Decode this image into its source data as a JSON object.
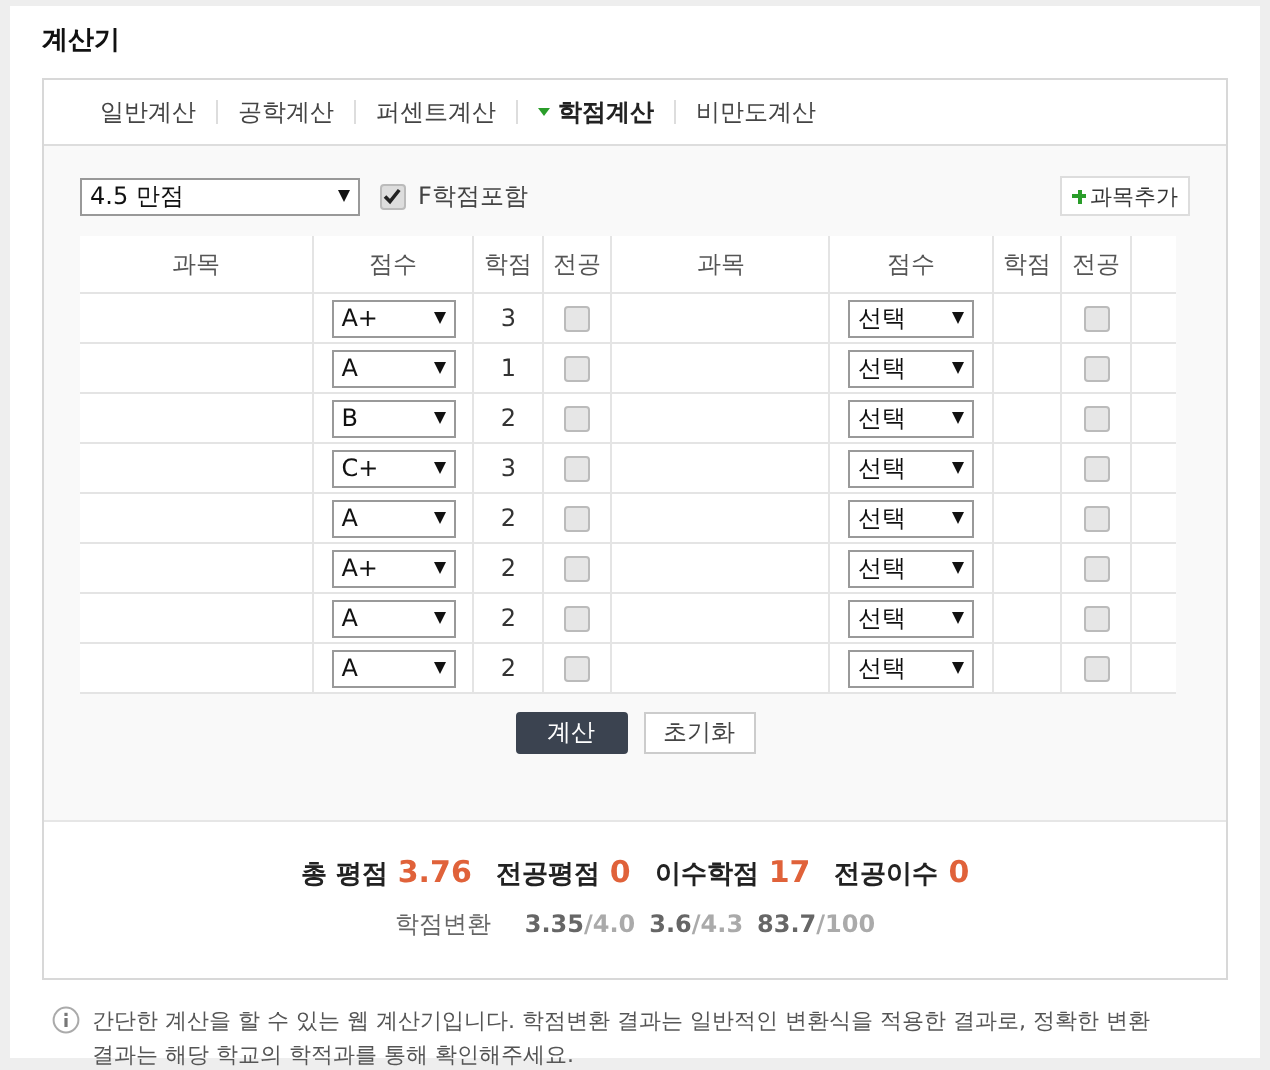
{
  "title": "계산기",
  "tabs": [
    {
      "label": "일반계산",
      "selected": false
    },
    {
      "label": "공학계산",
      "selected": false
    },
    {
      "label": "퍼센트계산",
      "selected": false
    },
    {
      "label": "학점계산",
      "selected": true
    },
    {
      "label": "비만도계산",
      "selected": false
    }
  ],
  "scale_select": {
    "value": "4.5 만점"
  },
  "include_f": {
    "label": "F학점포함",
    "checked": true
  },
  "add_button": {
    "label": "과목추가"
  },
  "table": {
    "columns": [
      "과목",
      "점수",
      "학점",
      "전공",
      "과목",
      "점수",
      "학점",
      "전공"
    ],
    "rows": [
      {
        "left": {
          "grade": "A+",
          "credit": "3",
          "major": false
        },
        "right": {
          "grade": "선택",
          "major": false
        }
      },
      {
        "left": {
          "grade": "A",
          "credit": "1",
          "major": false
        },
        "right": {
          "grade": "선택",
          "major": false
        }
      },
      {
        "left": {
          "grade": "B",
          "credit": "2",
          "major": false
        },
        "right": {
          "grade": "선택",
          "major": false
        }
      },
      {
        "left": {
          "grade": "C+",
          "credit": "3",
          "major": false
        },
        "right": {
          "grade": "선택",
          "major": false
        }
      },
      {
        "left": {
          "grade": "A",
          "credit": "2",
          "major": false
        },
        "right": {
          "grade": "선택",
          "major": false
        }
      },
      {
        "left": {
          "grade": "A+",
          "credit": "2",
          "major": false
        },
        "right": {
          "grade": "선택",
          "major": false
        }
      },
      {
        "left": {
          "grade": "A",
          "credit": "2",
          "major": false
        },
        "right": {
          "grade": "선택",
          "major": false
        }
      },
      {
        "left": {
          "grade": "A",
          "credit": "2",
          "major": false
        },
        "right": {
          "grade": "선택",
          "major": false
        }
      }
    ]
  },
  "buttons": [
    {
      "label": "계산",
      "kind": "primary"
    },
    {
      "label": "초기화",
      "kind": "secondary"
    }
  ],
  "results": [
    {
      "label": "총 평점",
      "value": "3.76"
    },
    {
      "label": "전공평점",
      "value": "0"
    },
    {
      "label": "이수학점",
      "value": "17"
    },
    {
      "label": "전공이수",
      "value": "0"
    }
  ],
  "conversion": {
    "label": "학점변환",
    "items": [
      {
        "value": "3.35",
        "scale": "/4.0"
      },
      {
        "value": "3.6",
        "scale": "/4.3"
      },
      {
        "value": "83.7",
        "scale": "/100"
      }
    ]
  },
  "note": "간단한 계산을 할 수 있는 웹 계산기입니다. 학점변환 결과는 일반적인 변환식을 적용한 결과로, 정확한 변환 결과는 해당 학교의 학적과를 통해 확인해주세요."
}
